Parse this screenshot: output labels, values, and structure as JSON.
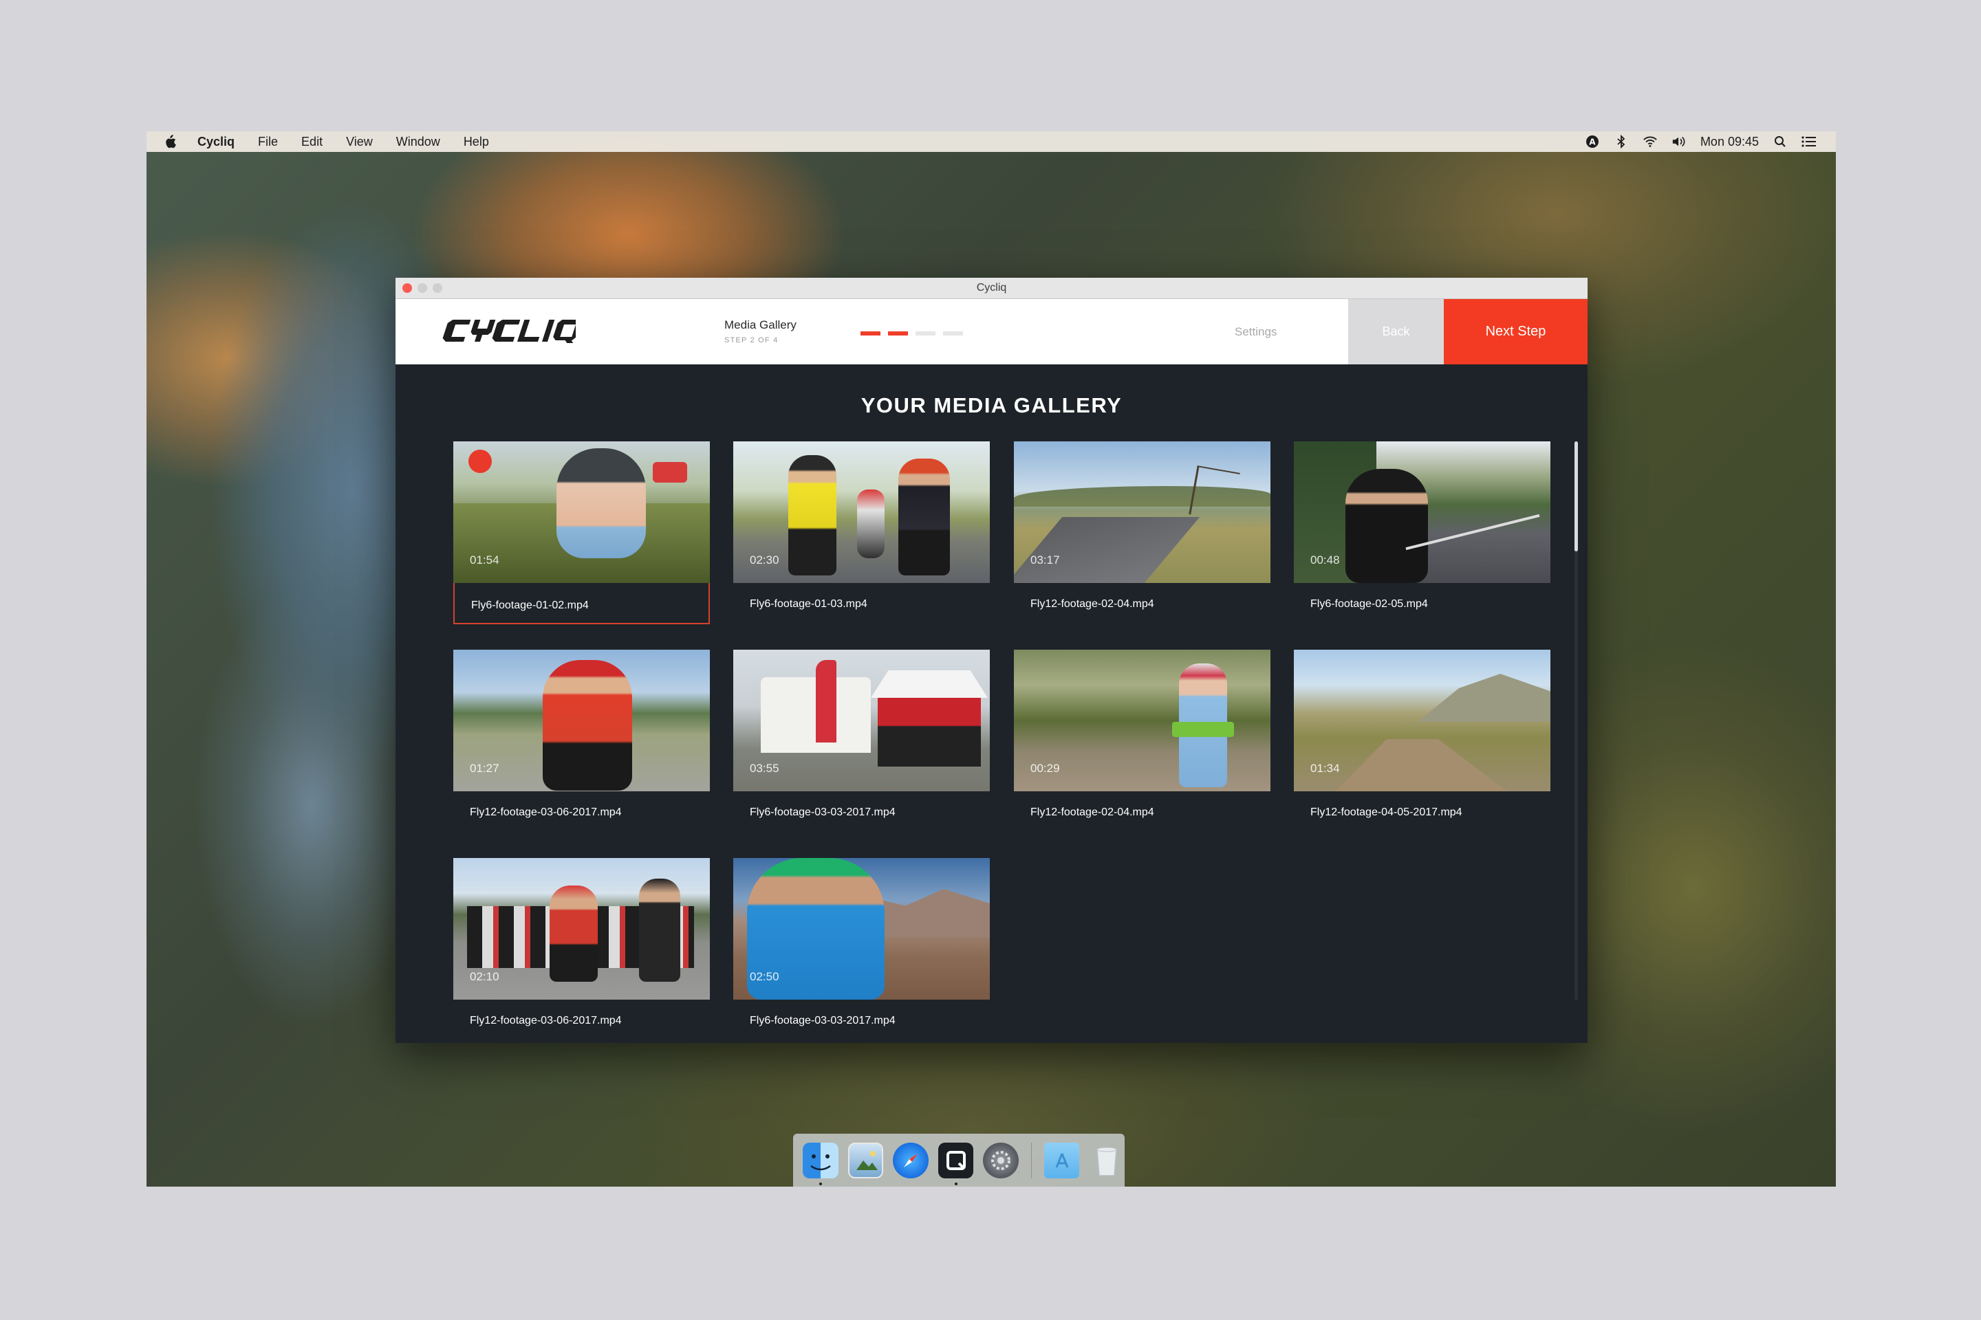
{
  "menubar": {
    "app_name": "Cycliq",
    "items": [
      "File",
      "Edit",
      "View",
      "Window",
      "Help"
    ],
    "clock": "Mon 09:45",
    "status_icons": [
      "input-source-icon",
      "bluetooth-icon",
      "wifi-icon",
      "volume-icon",
      "spotlight-icon",
      "notification-center-icon"
    ]
  },
  "window": {
    "title": "Cycliq"
  },
  "header": {
    "logo_text": "CYCLIQ",
    "step_title": "Media Gallery",
    "step_sub": "STEP 2 OF 4",
    "progress": {
      "current": 2,
      "total": 4
    },
    "settings_label": "Settings",
    "back_label": "Back",
    "next_label": "Next Step"
  },
  "gallery": {
    "title": "YOUR MEDIA GALLERY",
    "videos": [
      {
        "duration": "01:54",
        "filename": "Fly6-footage-01-02.mp4",
        "selected": true
      },
      {
        "duration": "02:30",
        "filename": "Fly6-footage-01-03.mp4",
        "selected": false
      },
      {
        "duration": "03:17",
        "filename": "Fly12-footage-02-04.mp4",
        "selected": false
      },
      {
        "duration": "00:48",
        "filename": "Fly6-footage-02-05.mp4",
        "selected": false
      },
      {
        "duration": "01:27",
        "filename": "Fly12-footage-03-06-2017.mp4",
        "selected": false
      },
      {
        "duration": "03:55",
        "filename": "Fly6-footage-03-03-2017.mp4",
        "selected": false
      },
      {
        "duration": "00:29",
        "filename": "Fly12-footage-02-04.mp4",
        "selected": false
      },
      {
        "duration": "01:34",
        "filename": "Fly12-footage-04-05-2017.mp4",
        "selected": false
      },
      {
        "duration": "02:10",
        "filename": "Fly12-footage-03-06-2017.mp4",
        "selected": false
      },
      {
        "duration": "02:50",
        "filename": "Fly6-footage-03-03-2017.mp4",
        "selected": false
      }
    ]
  },
  "dock": {
    "apps": [
      "finder-icon",
      "preview-icon",
      "safari-icon",
      "cycliq-icon",
      "system-preferences-icon",
      "applications-folder-icon",
      "trash-icon"
    ]
  },
  "colors": {
    "accent": "#f23b22",
    "window_bg": "#1e2329",
    "header_bg": "#ffffff"
  }
}
